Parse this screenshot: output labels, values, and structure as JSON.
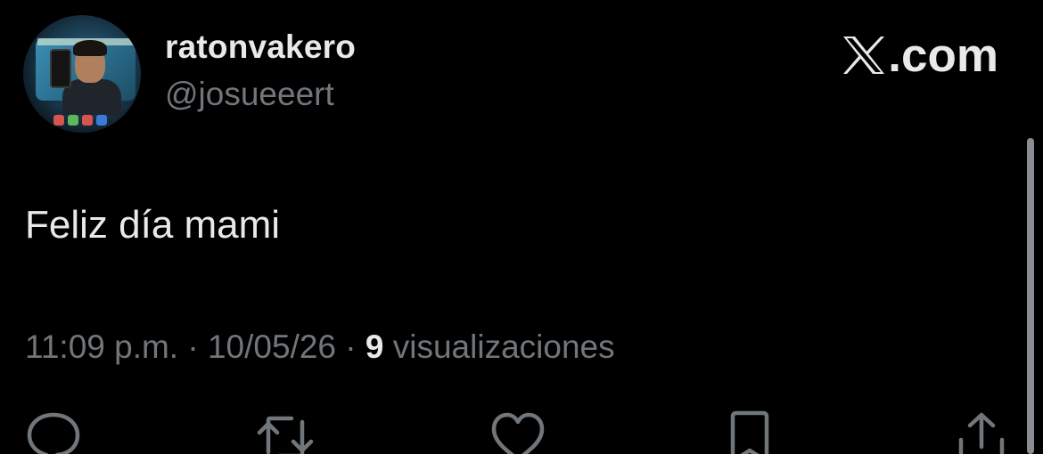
{
  "author": {
    "display_name": "ratonvakero",
    "handle": "@josueeert"
  },
  "brand": {
    "logo_icon": "x-logo-icon",
    "text": ".com"
  },
  "tweet": {
    "text": "Feliz día mami"
  },
  "meta": {
    "time": "11:09 p.m.",
    "separator1": " · ",
    "date": "10/05/26",
    "separator2": " · ",
    "views_count": "9",
    "views_label": " visualizaciones"
  },
  "actions": [
    {
      "name": "reply",
      "icon": "reply-icon"
    },
    {
      "name": "repost",
      "icon": "repost-icon"
    },
    {
      "name": "like",
      "icon": "heart-icon"
    },
    {
      "name": "bookmark",
      "icon": "bookmark-icon"
    },
    {
      "name": "share",
      "icon": "share-icon"
    }
  ],
  "colors": {
    "background": "#000000",
    "primary_text": "#e7e9ea",
    "secondary_text": "#71767b"
  }
}
